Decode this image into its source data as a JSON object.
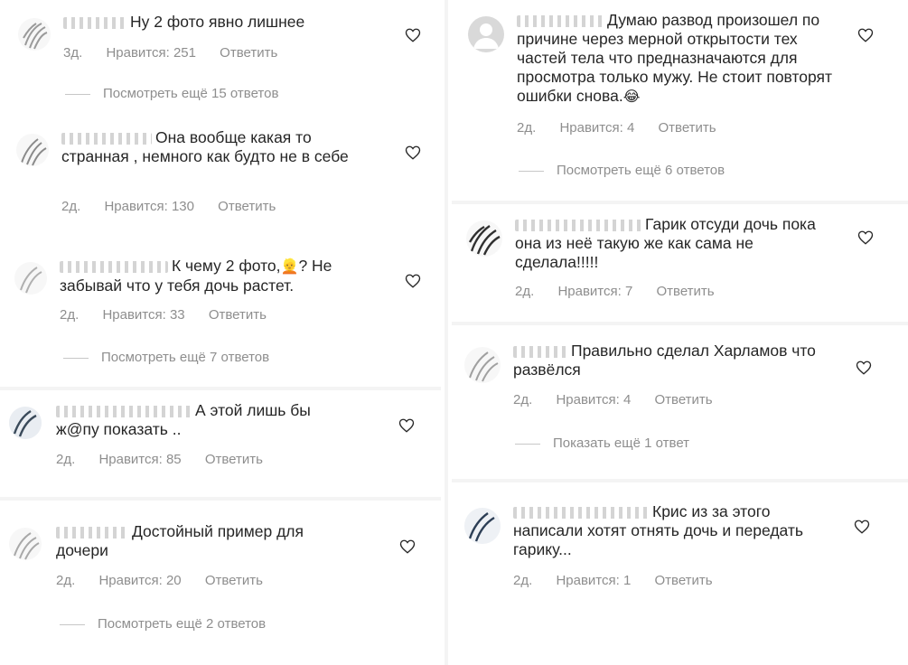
{
  "left_comments": [
    {
      "text": "Ну 2 фото явно лишнее",
      "age": "3д.",
      "likes": "Нравится: 251",
      "reply": "Ответить",
      "more": "Посмотреть ещё 15 ответов"
    },
    {
      "text": "Она вообще какая то странная , немного как будто не в себе",
      "age": "2д.",
      "likes": "Нравится: 130",
      "reply": "Ответить"
    },
    {
      "text_before": "К чему 2 фото,",
      "emoji": "👱",
      "text_after": "? Не забывай что у тебя дочь растет.",
      "age": "2д.",
      "likes": "Нравится: 33",
      "reply": "Ответить",
      "more": "Посмотреть ещё 7 ответов"
    },
    {
      "text": "А этой лишь бы ж@пу показать ..",
      "age": "2д.",
      "likes": "Нравится: 85",
      "reply": "Ответить"
    },
    {
      "text": "Достойный пример для дочери",
      "age": "2д.",
      "likes": "Нравится: 20",
      "reply": "Ответить",
      "more": "Посмотреть ещё 2 ответов"
    }
  ],
  "right_comments": [
    {
      "text": "Думаю развод произошел по причине через мерной открытости тех частей тела что предназначаются для просмотра только мужу. Не стоит повторят ошибки снова.",
      "emoji": "😂",
      "age": "2д.",
      "likes": "Нравится: 4",
      "reply": "Ответить",
      "more": "Посмотреть ещё 6 ответов"
    },
    {
      "text": "Гарик отсуди дочь пока она из неё такую же как сама  не сделала!!!!!",
      "age": "2д.",
      "likes": "Нравится: 7",
      "reply": "Ответить"
    },
    {
      "text": "Правильно сделал Харламов что развёлся",
      "age": "2д.",
      "likes": "Нравится: 4",
      "reply": "Ответить",
      "more": "Показать ещё 1 ответ"
    },
    {
      "text": "Крис из за этого написали хотят отнять дочь и передать гарику...",
      "age": "2д.",
      "likes": "Нравится: 1",
      "reply": "Ответить"
    }
  ],
  "icons": {
    "like": "heart-outline-icon",
    "avatar": "user-avatar"
  },
  "colors": {
    "text": "#262626",
    "meta": "#8e8e8e",
    "line": "#c7c7c7"
  }
}
